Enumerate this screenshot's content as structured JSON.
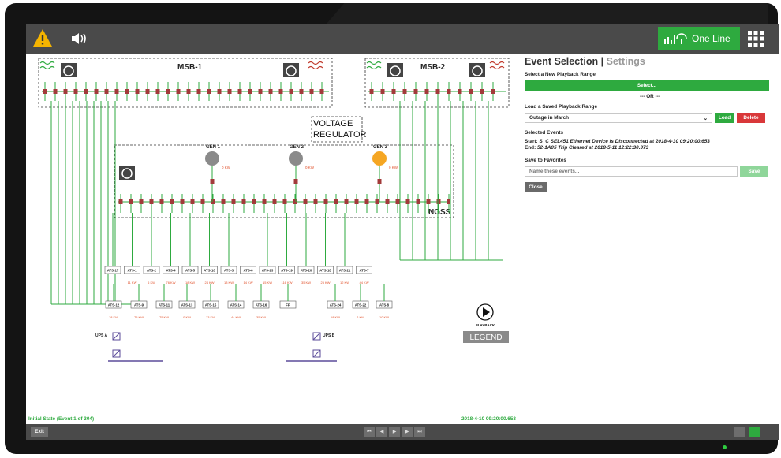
{
  "topbar": {
    "warning_icon": "warning-icon",
    "speaker_icon": "speaker-icon",
    "oneline_label": "One Line",
    "apps_icon": "grid-icon",
    "accent": "#2eaa3f"
  },
  "diagram": {
    "msb1": "MSB-1",
    "msb2": "MSB-2",
    "voltage_regulator_line1": "VOLTAGE",
    "voltage_regulator_line2": "REGULATOR",
    "ngss": "NGSS",
    "gens": [
      {
        "name": "GEN 1",
        "kw": "0 KW",
        "color": "#8a8a8a"
      },
      {
        "name": "GEN 2",
        "kw": "0 KW",
        "color": "#8a8a8a"
      },
      {
        "name": "GEN 3",
        "kw": "0 KW",
        "color": "#f5a623"
      }
    ],
    "ats_row1": [
      {
        "name": "ATS-17",
        "kw": ""
      },
      {
        "name": "ATS-1",
        "kw": "11 KW"
      },
      {
        "name": "ATS-2",
        "kw": "6 KW"
      },
      {
        "name": "ATS-4",
        "kw": "76 KW"
      },
      {
        "name": "ATS-5",
        "kw": "18 KW"
      },
      {
        "name": "ATS-10",
        "kw": "24 KW"
      },
      {
        "name": "ATS-3",
        "kw": "13 KW"
      },
      {
        "name": "ATS-6",
        "kw": "14 KW"
      },
      {
        "name": "ATS-23",
        "kw": "15 KW"
      },
      {
        "name": "ATS-19",
        "kw": "116 KW"
      },
      {
        "name": "ATS-20",
        "kw": "35 KW"
      },
      {
        "name": "ATS-18",
        "kw": "25 KW"
      },
      {
        "name": "ATS-21",
        "kw": "12 KW"
      },
      {
        "name": "ATS-7",
        "kw": "44 KW"
      }
    ],
    "ats_row2": [
      {
        "name": "ATS-12",
        "kw": "18 KW"
      },
      {
        "name": "ATS-9",
        "kw": "75 KW"
      },
      {
        "name": "ATS-11",
        "kw": "75 KW"
      },
      {
        "name": "ATS-13",
        "kw": "0 KW"
      },
      {
        "name": "ATS-15",
        "kw": "13 KW"
      },
      {
        "name": "ATS-14",
        "kw": "44 KW"
      },
      {
        "name": "ATS-16",
        "kw": "35 KW"
      },
      {
        "name": "FP",
        "kw": ""
      },
      {
        "name": "ATS-24",
        "kw": "18 KW"
      },
      {
        "name": "ATS-22",
        "kw": "2 KW"
      },
      {
        "name": "ATS-8",
        "kw": "10 KW"
      }
    ],
    "ups_a": "UPS A",
    "ups_b": "UPS B",
    "playback_label": "PLAYBACK",
    "legend_label": "LEGEND",
    "line_color": "#2eaa3f",
    "breaker_color": "#a23a3a"
  },
  "panel": {
    "title": "Event Selection",
    "separator": "|",
    "title_muted": "Settings",
    "new_range_label": "Select a New Playback Range",
    "select_button": "Select...",
    "or_label": "--- OR ---",
    "saved_range_label": "Load a Saved Playback Range",
    "saved_range_value": "Outage in March",
    "load_button": "Load",
    "delete_button": "Delete",
    "selected_events_label": "Selected Events",
    "start_label": "Start:",
    "start_value": "S_C SEL451 Ethernet Device is Disconnected at 2018-4-10 09:20:00.653",
    "end_label": "End:",
    "end_value": "52-1A05 Trip Cleared at 2018-5-11 12:22:30.973",
    "favorites_label": "Save to Favorites",
    "favorites_placeholder": "Name these events...",
    "save_button": "Save",
    "close_button": "Close",
    "delete_color": "#d9383a"
  },
  "status": {
    "left": "Initial State (Event 1 of 304)",
    "timestamp": "2018-4-10 09:20:00.653"
  },
  "bottombar": {
    "exit_button": "Exit",
    "playback_controls": [
      "skip-start-icon",
      "step-back-icon",
      "play-icon",
      "step-forward-icon",
      "skip-end-icon"
    ]
  }
}
